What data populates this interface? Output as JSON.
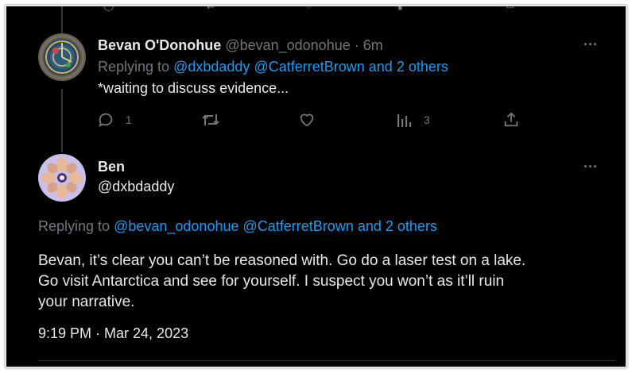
{
  "reply_tweet": {
    "display_name": "Bevan O'Donohue",
    "handle": "@bevan_odonohue",
    "separator": "·",
    "time_ago": "6m",
    "replying_to_prefix": "Replying to",
    "replying_to_users": [
      "@dxbdaddy",
      "@CatferretBrown"
    ],
    "replying_to_others": "and 2 others",
    "text": "*waiting to discuss evidence...",
    "reply_count": "1",
    "views_count": "3",
    "more_label": "···"
  },
  "main_tweet": {
    "display_name": "Ben",
    "handle": "@dxbdaddy",
    "replying_to_prefix": "Replying to",
    "replying_to_users": [
      "@bevan_odonohue",
      "@CatferretBrown"
    ],
    "replying_to_others": "and 2 others",
    "text_lines": [
      "Bevan, it’s clear you can’t be reasoned with. Go do a laser test on a lake.",
      "Go visit Antarctica and see for yourself. I suspect you won’t as it’ll ruin",
      "your narrative."
    ],
    "timestamp": "9:19 PM · Mar 24, 2023",
    "more_label": "···"
  },
  "colors": {
    "background": "#000000",
    "text": "#e7e9ea",
    "muted": "#71767b",
    "link": "#1d9bf0",
    "divider": "#2f3336"
  }
}
